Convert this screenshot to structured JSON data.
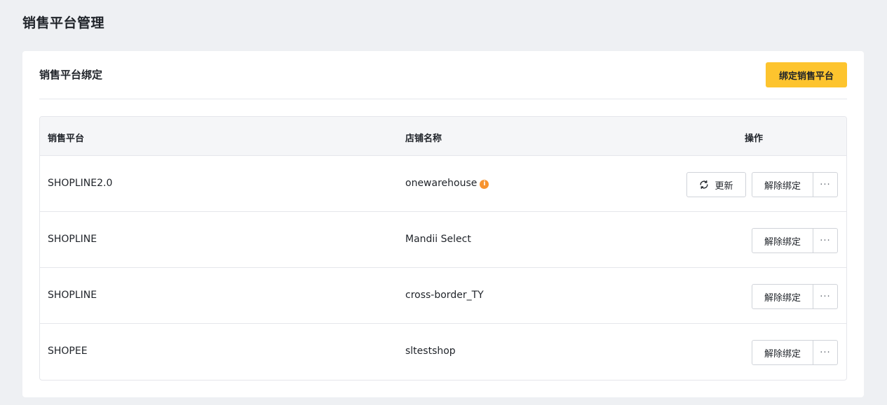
{
  "page": {
    "title": "销售平台管理"
  },
  "card": {
    "title": "销售平台绑定",
    "bind_button": "绑定销售平台"
  },
  "table": {
    "headers": {
      "platform": "销售平台",
      "store": "店铺名称",
      "operations": "操作"
    },
    "rows": [
      {
        "platform": "SHOPLINE2.0",
        "store": "onewarehouse",
        "has_info": true,
        "refresh_label": "更新",
        "unbind_label": "解除绑定",
        "more_label": "···"
      },
      {
        "platform": "SHOPLINE",
        "store": "Mandii Select",
        "unbind_label": "解除绑定",
        "more_label": "···"
      },
      {
        "platform": "SHOPLINE",
        "store": "cross-border_TY",
        "unbind_label": "解除绑定",
        "more_label": "···"
      },
      {
        "platform": "SHOPEE",
        "store": "sltestshop",
        "unbind_label": "解除绑定",
        "more_label": "···"
      }
    ]
  },
  "colors": {
    "accent": "#fdc42e",
    "info": "#f7932e",
    "background": "#eef0f3"
  },
  "icons": {
    "refresh": "refresh-icon",
    "info": "info-icon",
    "more": "more-icon"
  }
}
